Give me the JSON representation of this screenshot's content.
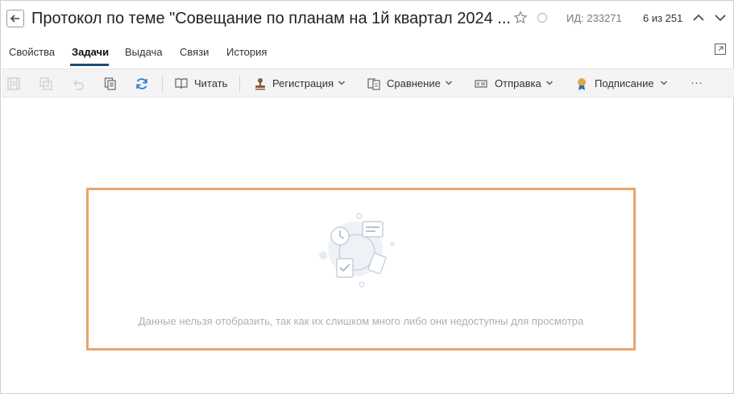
{
  "header": {
    "title": "Протокол по теме \"Совещание по планам на 1й квартал 2024 ...",
    "doc_id": "ИД: 233271",
    "counter": "6 из 251"
  },
  "tabs": [
    {
      "label": "Свойства",
      "active": false
    },
    {
      "label": "Задачи",
      "active": true
    },
    {
      "label": "Выдача",
      "active": false
    },
    {
      "label": "Связи",
      "active": false
    },
    {
      "label": "История",
      "active": false
    }
  ],
  "toolbar": {
    "read_label": "Читать",
    "registration_label": "Регистрация",
    "compare_label": "Сравнение",
    "send_label": "Отправка",
    "sign_label": "Подписание",
    "more_label": "···"
  },
  "empty_state": {
    "message": "Данные нельзя отобразить, так как их слишком много либо они недоступны для просмотра"
  },
  "colors": {
    "accent": "#1f4e79",
    "highlight_border": "#e8a56a",
    "refresh_blue": "#2a7fd4",
    "toolbar_bg": "#f4f4f4",
    "muted_text": "#a9b1bb"
  }
}
